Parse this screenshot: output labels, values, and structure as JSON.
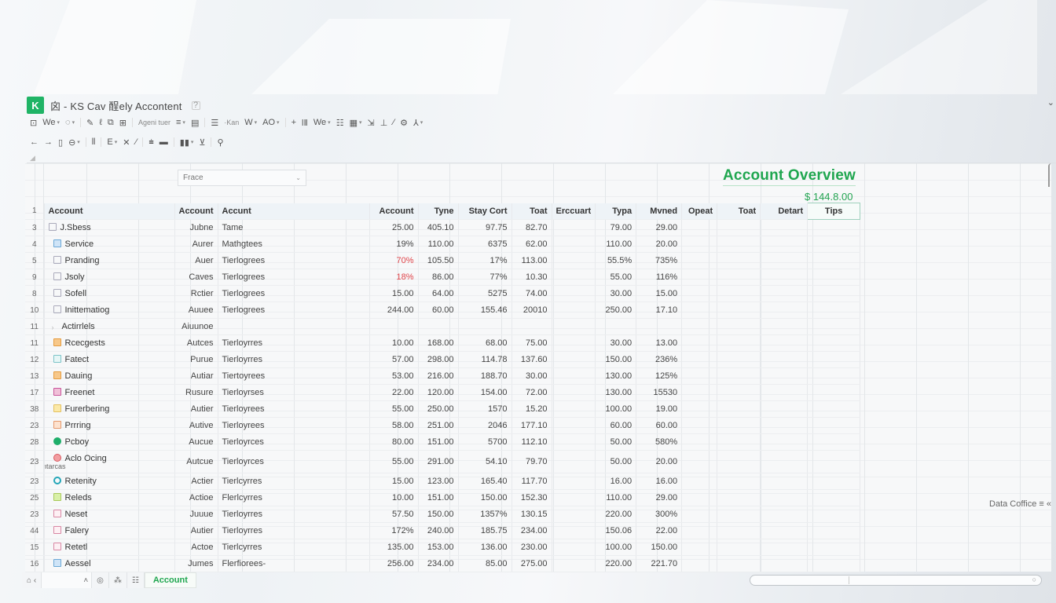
{
  "app": {
    "logo_letter": "K",
    "title": "囟 - KS  Cav  酲ely  Accontent",
    "help_icon": "?"
  },
  "toolbar1": [
    {
      "icon": "save-icon",
      "label": "⊡"
    },
    {
      "icon": "font-icon",
      "label": "We",
      "caret": true
    },
    {
      "icon": "paint-icon",
      "label": "◌",
      "caret": true
    },
    {
      "icon": "pen-icon",
      "label": "✎"
    },
    {
      "icon": "italic-icon",
      "label": "ℓ"
    },
    {
      "icon": "copy-icon",
      "label": "⧉"
    },
    {
      "icon": "table-icon",
      "label": "⊞"
    },
    {
      "icon": "text-label",
      "label": "Ageni tuer",
      "small": true
    },
    {
      "icon": "align-icon",
      "label": "≡",
      "caret": true
    },
    {
      "icon": "wrap-icon",
      "label": "▤"
    },
    {
      "icon": "list-icon",
      "label": "☰"
    },
    {
      "icon": "kan-icon",
      "label": "·Kan",
      "small": true
    },
    {
      "icon": "word-icon",
      "label": "W",
      "caret": true
    },
    {
      "icon": "ao-icon",
      "label": "AO",
      "caret": true
    },
    {
      "icon": "plus-icon",
      "label": "+"
    },
    {
      "icon": "column-icon",
      "label": "lⅡ"
    },
    {
      "icon": "we2-icon",
      "label": "We",
      "caret": true
    },
    {
      "icon": "rows-icon",
      "label": "☷"
    },
    {
      "icon": "calendar-icon",
      "label": "▦",
      "caret": true
    },
    {
      "icon": "chart-icon",
      "label": "⇲"
    },
    {
      "icon": "underline-icon",
      "label": "⊥"
    },
    {
      "icon": "slash-icon",
      "label": "∕"
    },
    {
      "icon": "settings-icon",
      "label": "⚙"
    },
    {
      "icon": "person-icon",
      "label": "⅄",
      "caret": true
    }
  ],
  "toolbar2": [
    {
      "icon": "back-icon",
      "label": "←"
    },
    {
      "icon": "forward-icon",
      "label": "→"
    },
    {
      "icon": "clipboard-icon",
      "label": "▯"
    },
    {
      "icon": "link-icon",
      "label": "⊖",
      "caret": true
    },
    {
      "icon": "format-icon",
      "label": "⫴"
    },
    {
      "icon": "border-icon",
      "label": "E",
      "caret": true
    },
    {
      "icon": "clear-icon",
      "label": "✕"
    },
    {
      "icon": "slash2-icon",
      "label": "⁄"
    },
    {
      "icon": "filter-icon",
      "label": "⩧"
    },
    {
      "icon": "comment-icon",
      "label": "▬"
    },
    {
      "icon": "bars-icon",
      "label": "▮▮",
      "caret": true
    },
    {
      "icon": "sort-icon",
      "label": "⊻"
    },
    {
      "icon": "search-icon",
      "label": "⚲"
    }
  ],
  "filter": {
    "value": "Frace"
  },
  "overview": {
    "title": "Account Overview",
    "amount": "$ 144.8.00"
  },
  "headers": {
    "rownum": "1",
    "name": "Account",
    "status": "Account",
    "type": "Accunt",
    "c1": "Account",
    "c2": "Tyne",
    "c3": "Stay Cort",
    "c4": "Toat",
    "c5": "Erccuart",
    "c6": "Typa",
    "c7": "Mvned",
    "c8": "Opeat",
    "c9": "Toat",
    "c10": "Detart",
    "c11": "Tips"
  },
  "rows": [
    {
      "rn": "3",
      "icon": "doc-icon",
      "icls": "ic-doc",
      "name": "J.Sbess",
      "status": "Jubne",
      "type": "Tame",
      "c1": "25.00",
      "c2": "405.10",
      "c3": "97.75",
      "c4": "82.70",
      "c6": "79.00",
      "c7": "29.00"
    },
    {
      "rn": "4",
      "icon": "building-icon",
      "icls": "ic-blue",
      "name": "Service",
      "status": "Aurer",
      "type": "Mathgtees",
      "c1": "19%",
      "c2": "110.00",
      "c3": "6375",
      "c4": "62.00",
      "c6": "110.00",
      "c7": "20.00"
    },
    {
      "rn": "5",
      "icon": "folder-icon",
      "icls": "ic-doc",
      "name": "Pranding",
      "status": "Auer",
      "type": "Tierlogrees",
      "c1": "70%",
      "c1red": true,
      "c2": "105.50",
      "c3": "17%",
      "c4": "113.00",
      "c6": "55.5%",
      "c7": "735%"
    },
    {
      "rn": "9",
      "icon": "file-icon",
      "icls": "ic-doc",
      "name": "Jsoly",
      "status": "Caves",
      "type": "Tierlogrees",
      "c1": "18%",
      "c1red": true,
      "c2": "86.00",
      "c3": "77%",
      "c4": "10.30",
      "c6": "55.00",
      "c7": "116%"
    },
    {
      "rn": "8",
      "icon": "image-icon",
      "icls": "ic-doc",
      "name": "Sofell",
      "status": "Rctier",
      "type": "Tierlogrees",
      "c1": "15.00",
      "c2": "64.00",
      "c3": "5275",
      "c4": "74.00",
      "c6": "30.00",
      "c7": "15.00"
    },
    {
      "rn": "10",
      "icon": "sheet-icon",
      "icls": "ic-doc",
      "name": "Inittematiog",
      "status": "Auuee",
      "type": "Tierlogrees",
      "c1": "244.00",
      "c2": "60.00",
      "c3": "155.46",
      "c4": "20010",
      "c6": "250.00",
      "c7": "17.10"
    },
    {
      "rn": "11",
      "icon": "arrow-icon",
      "icls": "ic-arrow",
      "name": "Actirrlels",
      "status": "Aiuunoe",
      "type": "",
      "c1": "",
      "c2": "",
      "c3": "",
      "c4": "",
      "c6": "",
      "c7": "",
      "indent": true
    },
    {
      "rn": "11",
      "icon": "calendar-icon",
      "icls": "ic-orange",
      "name": "Rcecgests",
      "status": "Autces",
      "type": "Tierloyrres",
      "c1": "10.00",
      "c2": "168.00",
      "c3": "68.00",
      "c4": "75.00",
      "c6": "30.00",
      "c7": "13.00"
    },
    {
      "rn": "12",
      "icon": "box-icon",
      "icls": "ic-teal",
      "name": "Fatect",
      "status": "Purue",
      "type": "Tierloyrres",
      "c1": "57.00",
      "c2": "298.00",
      "c3": "114.78",
      "c4": "137.60",
      "c6": "150.00",
      "c7": "236%"
    },
    {
      "rn": "13",
      "icon": "people-icon",
      "icls": "ic-orange",
      "name": "Dauing",
      "status": "Autiar",
      "type": "Tiertoyrees",
      "c1": "53.00",
      "c2": "216.00",
      "c3": "188.70",
      "c4": "30.00",
      "c6": "130.00",
      "c7": "125%"
    },
    {
      "rn": "17",
      "icon": "glass-icon",
      "icls": "ic-pink",
      "name": "Freenet",
      "status": "Rusure",
      "type": "Tierloyrses",
      "c1": "22.00",
      "c2": "120.00",
      "c3": "154.00",
      "c4": "72.00",
      "c6": "130.00",
      "c7": "15530"
    },
    {
      "rn": "38",
      "icon": "grid-icon",
      "icls": "ic-yellow",
      "name": "Furerbering",
      "status": "Autier",
      "type": "Tierloyrees",
      "c1": "55.00",
      "c2": "250.00",
      "c3": "1570",
      "c4": "15.20",
      "c6": "100.00",
      "c7": "19.00"
    },
    {
      "rn": "23",
      "icon": "card-icon",
      "icls": "ic-peach",
      "name": "Prrring",
      "status": "Autive",
      "type": "Tierloyrees",
      "c1": "58.00",
      "c2": "251.00",
      "c3": "2046",
      "c4": "177.10",
      "c6": "60.00",
      "c7": "60.00"
    },
    {
      "rn": "28",
      "icon": "circle-icon",
      "icls": "ic-green",
      "name": "Pcboy",
      "status": "Aucue",
      "type": "Tierloyrces",
      "c1": "80.00",
      "c2": "151.00",
      "c3": "5700",
      "c4": "112.10",
      "c6": "50.00",
      "c7": "580%"
    },
    {
      "rn": "23",
      "icon": "dot-icon",
      "icls": "ic-red",
      "name": "Aclo Ocing",
      "sub": "Intarcas",
      "status": "Autcue",
      "type": "Tierloyrces",
      "c1": "55.00",
      "c2": "291.00",
      "c3": "54.10",
      "c4": "79.70",
      "c6": "50.00",
      "c7": "20.00",
      "tall": true
    },
    {
      "rn": "23",
      "icon": "clock-icon",
      "icls": "ic-cyan",
      "name": "Retenity",
      "status": "Actier",
      "type": "Tierlcyrres",
      "c1": "15.00",
      "c2": "123.00",
      "c3": "165.40",
      "c4": "117.70",
      "c6": "16.00",
      "c7": "16.00"
    },
    {
      "rn": "25",
      "icon": "note-icon",
      "icls": "ic-lime",
      "name": "Releds",
      "status": "Actioe",
      "type": "Flerlcyrres",
      "c1": "10.00",
      "c2": "151.00",
      "c3": "150.00",
      "c4": "152.30",
      "c6": "110.00",
      "c7": "29.00"
    },
    {
      "rn": "23",
      "icon": "page-icon",
      "icls": "ic-rose",
      "name": "Neset",
      "status": "Juuue",
      "type": "Tierloyrres",
      "c1": "57.50",
      "c2": "150.00",
      "c3": "1357%",
      "c4": "130.15",
      "c6": "220.00",
      "c7": "300%"
    },
    {
      "rn": "44",
      "icon": "window-icon",
      "icls": "ic-rose",
      "name": "Falery",
      "status": "Autier",
      "type": "Tierloyrres",
      "c1": "172%",
      "c2": "240.00",
      "c3": "185.75",
      "c4": "234.00",
      "c6": "150.06",
      "c7": "22.00"
    },
    {
      "rn": "15",
      "icon": "panel-icon",
      "icls": "ic-rose",
      "name": "Retetl",
      "status": "Actoe",
      "type": "Tierlcyrres",
      "c1": "135.00",
      "c2": "153.00",
      "c3": "136.00",
      "c4": "230.00",
      "c6": "100.00",
      "c7": "150.00"
    },
    {
      "rn": "16",
      "icon": "trash-icon",
      "icls": "ic-blue",
      "name": "Aessel",
      "status": "Jumes",
      "type": "Flerfiorees-",
      "c1": "256.00",
      "c2": "234.00",
      "c3": "85.00",
      "c4": "275.00",
      "c6": "220.00",
      "c7": "221.70"
    }
  ],
  "bottom": {
    "nav_home": "⌂ ‹",
    "nav_dropdown": "˄",
    "target_icon": "◎",
    "sparkle_icon": "⁂",
    "list_icon": "☷",
    "active_sheet": "Account"
  },
  "status": {
    "text": "Data Coffice",
    "suffix": "≡ «"
  }
}
